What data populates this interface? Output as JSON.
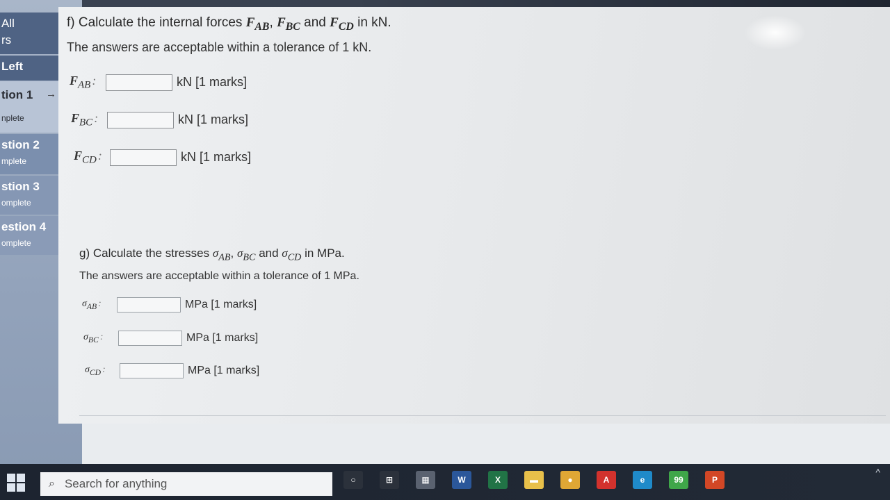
{
  "sidebar": {
    "all_label": "All",
    "rs_label": "rs",
    "left_label": "Left",
    "items": [
      {
        "label": "tion 1",
        "status": "nplete"
      },
      {
        "label": "stion 2",
        "status": "mplete"
      },
      {
        "label": "stion 3",
        "status": "omplete"
      },
      {
        "label": "estion 4",
        "status": "omplete"
      }
    ],
    "arrow": "→"
  },
  "question_f": {
    "title_prefix": "f) Calculate the internal forces",
    "var1": "F",
    "sub1": "AB",
    "var2": "F",
    "sub2": "BC",
    "and_text": "and",
    "var3": "F",
    "sub3": "CD",
    "title_suffix": "in kN.",
    "tolerance": "The answers are acceptable within a tolerance of 1 kN.",
    "rows": [
      {
        "label": "F",
        "sub": "AB",
        "unit": "kN [1 marks]",
        "value": ""
      },
      {
        "label": "F",
        "sub": "BC",
        "unit": "kN [1 marks]",
        "value": ""
      },
      {
        "label": "F",
        "sub": "CD",
        "unit": "kN [1 marks]",
        "value": ""
      }
    ]
  },
  "question_g": {
    "title_prefix": "g) Calculate the stresses",
    "var1": "σ",
    "sub1": "AB",
    "var2": "σ",
    "sub2": "BC",
    "and_text": "and",
    "var3": "σ",
    "sub3": "CD",
    "title_suffix": "in MPa.",
    "tolerance": "The answers are acceptable within a tolerance of 1 MPa.",
    "rows": [
      {
        "label": "σ",
        "sub": "AB",
        "unit": "MPa [1 marks]",
        "value": ""
      },
      {
        "label": "σ",
        "sub": "BC",
        "unit": "MPa [1 marks]",
        "value": ""
      },
      {
        "label": "σ",
        "sub": "CD",
        "unit": "MPa [1 marks]",
        "value": ""
      }
    ]
  },
  "taskbar": {
    "search_placeholder": "Search for anything",
    "icons": [
      {
        "name": "cortana-icon",
        "glyph": "○",
        "color": "#2b313b"
      },
      {
        "name": "task-view-icon",
        "glyph": "⊞",
        "color": "#2b313b"
      },
      {
        "name": "store-icon",
        "glyph": "▦",
        "color": "#5a6270"
      },
      {
        "name": "word-icon",
        "glyph": "W",
        "color": "#2b579a"
      },
      {
        "name": "excel-icon",
        "glyph": "X",
        "color": "#217346"
      },
      {
        "name": "file-explorer-icon",
        "glyph": "▬",
        "color": "#e8c04a"
      },
      {
        "name": "chrome-icon",
        "glyph": "●",
        "color": "#dfa735"
      },
      {
        "name": "acrobat-icon",
        "glyph": "A",
        "color": "#d2322d"
      },
      {
        "name": "edge-icon",
        "glyph": "e",
        "color": "#1f8ac9"
      },
      {
        "name": "whatsapp-icon",
        "glyph": "99",
        "color": "#3fa649"
      },
      {
        "name": "powerpoint-icon",
        "glyph": "P",
        "color": "#d24726"
      }
    ],
    "tray_arrow": "^"
  }
}
